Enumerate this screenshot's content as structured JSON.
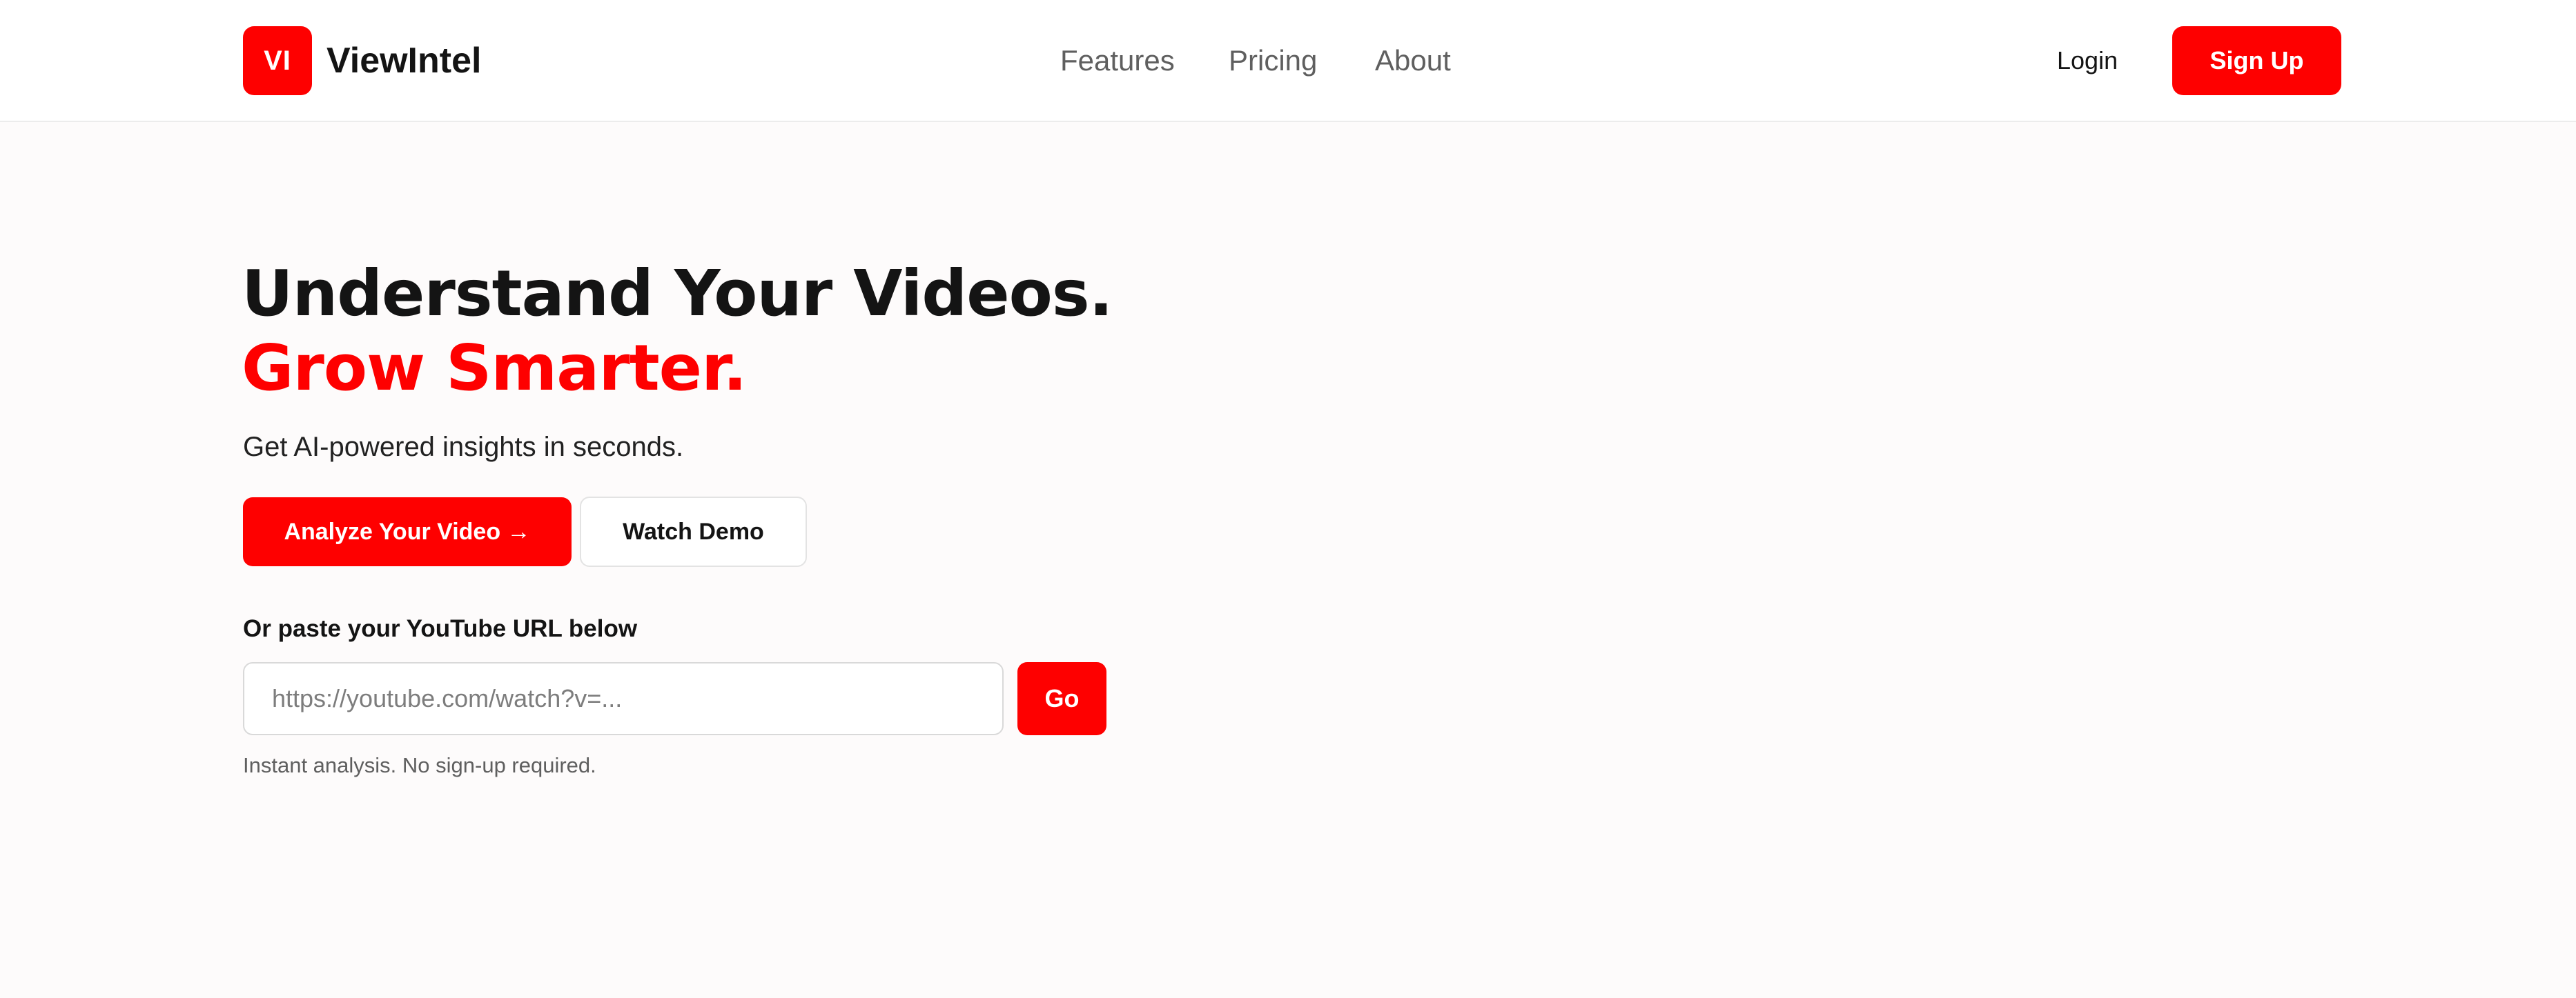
{
  "brand": {
    "logo_initials": "VI",
    "name": "ViewIntel",
    "accent_color": "#fe0000"
  },
  "nav": {
    "items": [
      {
        "label": "Features"
      },
      {
        "label": "Pricing"
      },
      {
        "label": "About"
      }
    ]
  },
  "auth": {
    "login_label": "Login",
    "signup_label": "Sign Up"
  },
  "hero": {
    "title_line1": "Understand Your Videos.",
    "title_line2": "Grow Smarter.",
    "subtitle": "Get AI-powered insights in seconds.",
    "primary_cta": "Analyze Your Video →",
    "secondary_cta": "Watch Demo"
  },
  "url_form": {
    "label": "Or paste your YouTube URL below",
    "placeholder": "https://youtube.com/watch?v=...",
    "value": "",
    "submit_label": "Go",
    "note": "Instant analysis. No sign-up required."
  }
}
